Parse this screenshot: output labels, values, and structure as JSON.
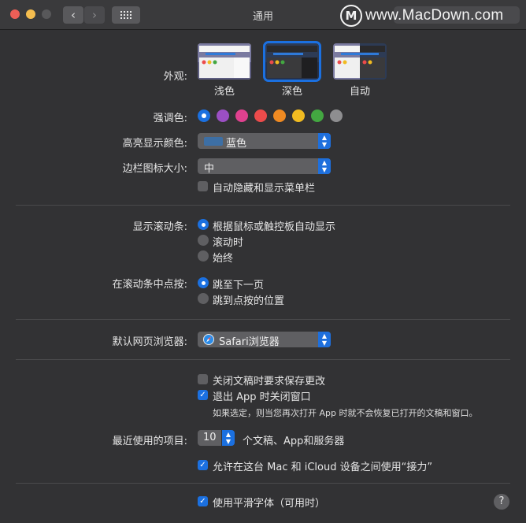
{
  "window": {
    "title": "通用"
  },
  "watermark": {
    "logo": "M",
    "text": "www.MacDown.com"
  },
  "appearance": {
    "label": "外观:",
    "options": [
      {
        "name": "浅色"
      },
      {
        "name": "深色",
        "selected": true
      },
      {
        "name": "自动"
      }
    ]
  },
  "accent": {
    "label": "强调色:",
    "colors": [
      "#1b70e0",
      "#9b4fc4",
      "#e0418f",
      "#ec4b4b",
      "#ef8a22",
      "#f1bb21",
      "#43a741",
      "#8e8e90"
    ],
    "selected_index": 0
  },
  "highlight": {
    "label": "高亮显示颜色:",
    "value": "蓝色",
    "swatch": "#3d6fa5"
  },
  "sidebar_icon": {
    "label": "边栏图标大小:",
    "value": "中"
  },
  "menubar": {
    "label": "自动隐藏和显示菜单栏",
    "checked": false
  },
  "scrollbars": {
    "label": "显示滚动条:",
    "options": [
      {
        "label": "根据鼠标或触控板自动显示",
        "selected": true
      },
      {
        "label": "滚动时",
        "selected": false
      },
      {
        "label": "始终",
        "selected": false
      }
    ]
  },
  "click_scrollbar": {
    "label": "在滚动条中点按:",
    "options": [
      {
        "label": "跳至下一页",
        "selected": true
      },
      {
        "label": "跳到点按的位置",
        "selected": false
      }
    ]
  },
  "browser": {
    "label": "默认网页浏览器:",
    "value": "Safari浏览器"
  },
  "docs": {
    "ask_save": {
      "label": "关闭文稿时要求保存更改",
      "checked": false
    },
    "close_windows": {
      "label": "退出 App 时关闭窗口",
      "checked": true
    },
    "note": "如果选定，则当您再次打开 App 时就不会恢复已打开的文稿和窗口。"
  },
  "recent": {
    "label": "最近使用的项目:",
    "value": "10",
    "suffix": "个文稿、App和服务器"
  },
  "handoff": {
    "label": "允许在这台 Mac 和 iCloud 设备之间使用“接力”",
    "checked": true
  },
  "font_smoothing": {
    "label": "使用平滑字体（可用时）",
    "checked": true
  },
  "help": {
    "label": "?"
  }
}
